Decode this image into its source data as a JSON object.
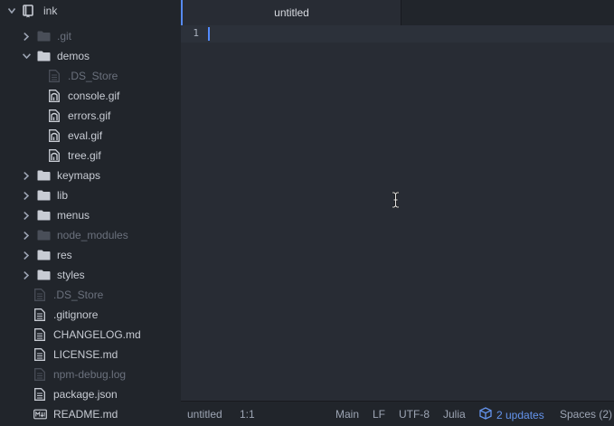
{
  "project": {
    "name": "ink"
  },
  "tree": [
    {
      "label": ".git",
      "type": "folder",
      "expanded": false,
      "depth": 1,
      "ignored": true
    },
    {
      "label": "demos",
      "type": "folder",
      "expanded": true,
      "depth": 1,
      "ignored": false
    },
    {
      "label": ".DS_Store",
      "type": "file",
      "icon": "file-text-icon",
      "depth": 2,
      "ignored": true
    },
    {
      "label": "console.gif",
      "type": "file",
      "icon": "image-file-icon",
      "depth": 2,
      "ignored": false
    },
    {
      "label": "errors.gif",
      "type": "file",
      "icon": "image-file-icon",
      "depth": 2,
      "ignored": false
    },
    {
      "label": "eval.gif",
      "type": "file",
      "icon": "image-file-icon",
      "depth": 2,
      "ignored": false
    },
    {
      "label": "tree.gif",
      "type": "file",
      "icon": "image-file-icon",
      "depth": 2,
      "ignored": false
    },
    {
      "label": "keymaps",
      "type": "folder",
      "expanded": false,
      "depth": 1,
      "ignored": false
    },
    {
      "label": "lib",
      "type": "folder",
      "expanded": false,
      "depth": 1,
      "ignored": false
    },
    {
      "label": "menus",
      "type": "folder",
      "expanded": false,
      "depth": 1,
      "ignored": false
    },
    {
      "label": "node_modules",
      "type": "folder",
      "expanded": false,
      "depth": 1,
      "ignored": true
    },
    {
      "label": "res",
      "type": "folder",
      "expanded": false,
      "depth": 1,
      "ignored": false
    },
    {
      "label": "styles",
      "type": "folder",
      "expanded": false,
      "depth": 1,
      "ignored": false
    },
    {
      "label": ".DS_Store",
      "type": "file",
      "icon": "file-text-icon",
      "depth": 1,
      "ignored": true
    },
    {
      "label": ".gitignore",
      "type": "file",
      "icon": "file-text-icon",
      "depth": 1,
      "ignored": false
    },
    {
      "label": "CHANGELOG.md",
      "type": "file",
      "icon": "file-text-icon",
      "depth": 1,
      "ignored": false
    },
    {
      "label": "LICENSE.md",
      "type": "file",
      "icon": "file-text-icon",
      "depth": 1,
      "ignored": false
    },
    {
      "label": "npm-debug.log",
      "type": "file",
      "icon": "file-text-icon",
      "depth": 1,
      "ignored": true
    },
    {
      "label": "package.json",
      "type": "file",
      "icon": "file-text-icon",
      "depth": 1,
      "ignored": false
    },
    {
      "label": "README.md",
      "type": "file",
      "icon": "markdown-file-icon",
      "depth": 1,
      "ignored": false
    }
  ],
  "tabs": [
    {
      "label": "untitled",
      "active": true
    }
  ],
  "editor": {
    "line_numbers": [
      "1"
    ]
  },
  "status": {
    "file": "untitled",
    "cursor": "1:1",
    "branch": "Main",
    "line_ending": "LF",
    "encoding": "UTF-8",
    "grammar": "Julia",
    "updates": "2 updates",
    "indent": "Spaces (2)"
  },
  "colors": {
    "accent": "#568af2",
    "updates": "#6494ed",
    "background": "#282c34",
    "panel": "#21252b"
  }
}
